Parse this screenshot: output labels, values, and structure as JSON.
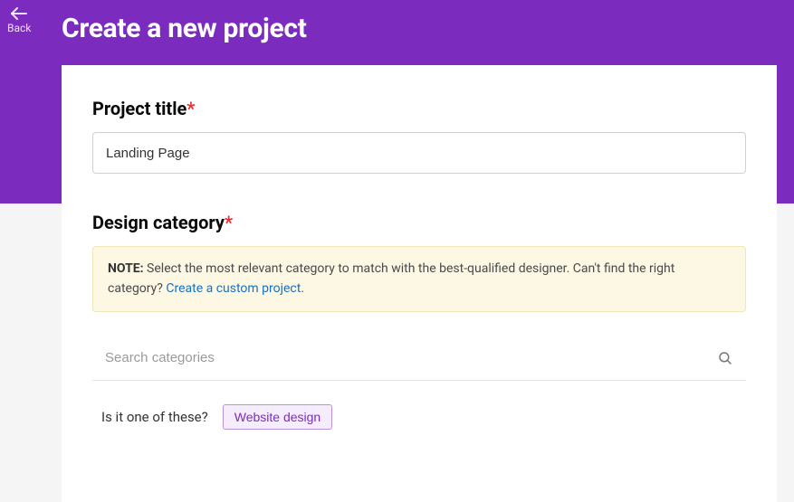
{
  "header": {
    "back_label": "Back",
    "page_title": "Create a new project"
  },
  "project_title": {
    "label": "Project title",
    "required_marker": "*",
    "value": "Landing Page"
  },
  "design_category": {
    "label": "Design category",
    "required_marker": "*",
    "note_label": "NOTE:",
    "note_text": " Select the most relevant category to match with the best-qualified designer. Can't find the right category? ",
    "note_link_text": "Create a custom project",
    "note_period": ".",
    "search_placeholder": "Search categories",
    "suggestion_label": "Is it one of these?",
    "suggestion_chip": "Website design"
  }
}
